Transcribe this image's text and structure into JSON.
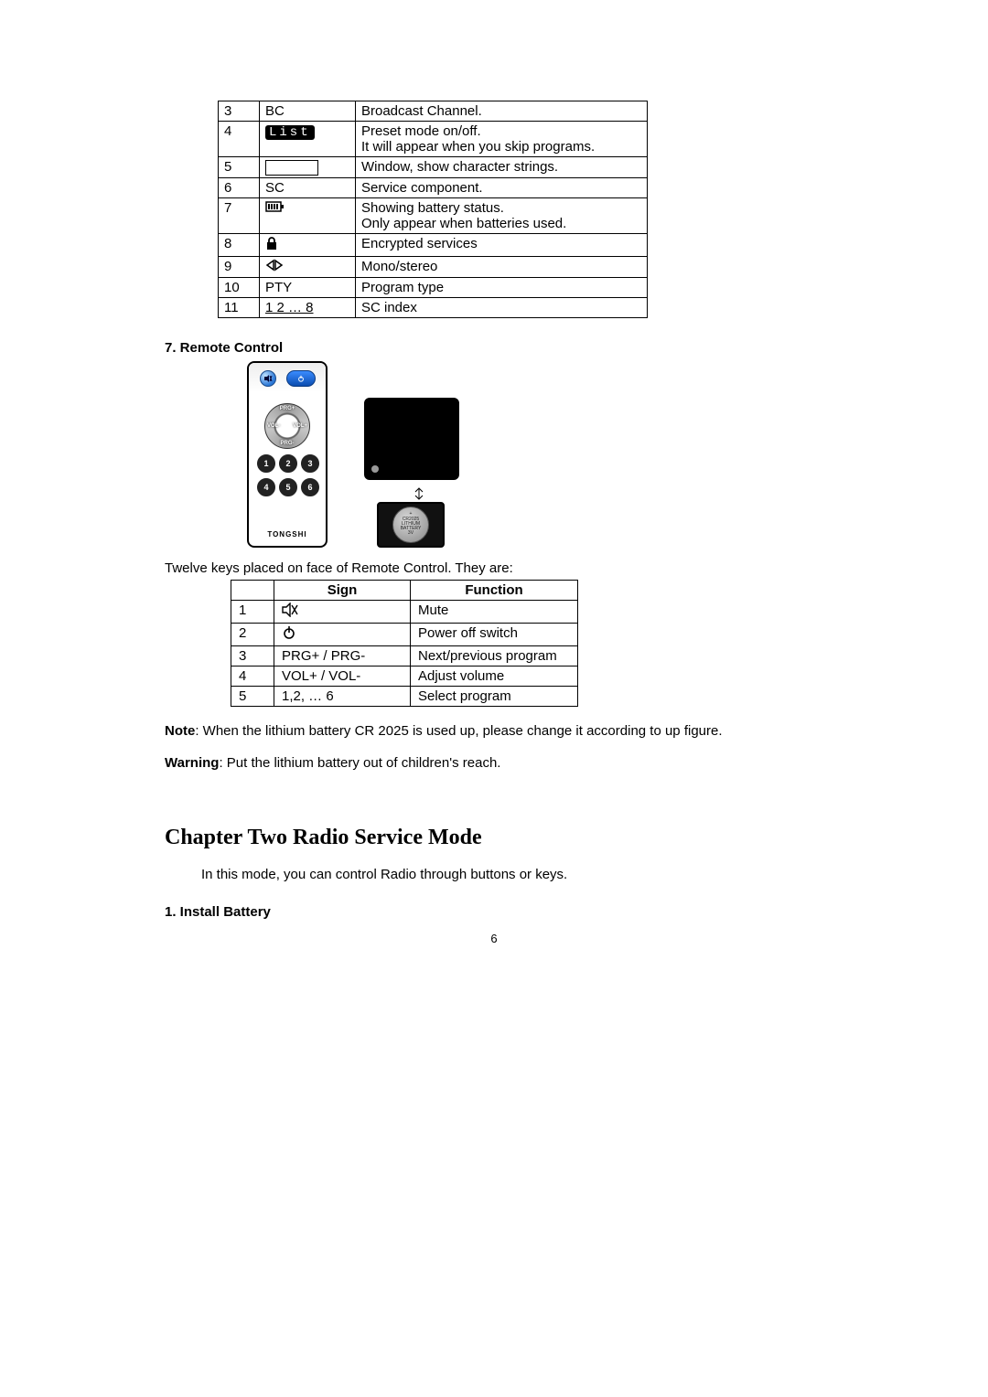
{
  "table1": {
    "rows": [
      {
        "num": "3",
        "sign": "BC",
        "desc": "Broadcast Channel."
      },
      {
        "num": "4",
        "sign": "List",
        "desc": "Preset mode on/off.\nIt will appear when you skip programs."
      },
      {
        "num": "5",
        "sign": "[window]",
        "desc": "Window, show character strings."
      },
      {
        "num": "6",
        "sign": "SC",
        "desc": "Service component."
      },
      {
        "num": "7",
        "sign": "battery-icon",
        "desc": "Showing battery status.\nOnly appear when batteries used."
      },
      {
        "num": "8",
        "sign": "lock-icon",
        "desc": "Encrypted services"
      },
      {
        "num": "9",
        "sign": "mono-stereo-icon",
        "desc": "Mono/stereo"
      },
      {
        "num": "10",
        "sign": "PTY",
        "desc": "Program type"
      },
      {
        "num": "11",
        "sign": "1 2 … 8",
        "desc": "SC index"
      }
    ]
  },
  "section7_title": "7. Remote Control",
  "remote": {
    "brand": "TONGSHI",
    "ring": {
      "up": "PRG+",
      "down": "PRG-",
      "left": "VOL-",
      "right": "VOL+"
    },
    "numbers": [
      "1",
      "2",
      "3",
      "4",
      "5",
      "6"
    ],
    "mute_icon": "mute-icon",
    "power_icon": "power-icon",
    "coin_label": "+\nCR2025\nLITHIUM\nBATTERY\n3V"
  },
  "keys_intro": "Twelve keys placed on face of Remote Control. They are:",
  "table2": {
    "headers": {
      "sign": "Sign",
      "func": "Function"
    },
    "rows": [
      {
        "num": "1",
        "sign": "mute-icon",
        "func": "Mute"
      },
      {
        "num": "2",
        "sign": "power-icon",
        "func": "Power off switch"
      },
      {
        "num": "3",
        "sign": "PRG+ / PRG-",
        "func": "Next/previous program"
      },
      {
        "num": "4",
        "sign": "VOL+ / VOL-",
        "func": "Adjust volume"
      },
      {
        "num": "5",
        "sign": "1,2, … 6",
        "func": "Select program"
      }
    ]
  },
  "note_label": "Note",
  "note_text": ": When the lithium battery CR 2025 is used up, please change it according to up figure.",
  "warning_label": "Warning",
  "warning_text": ": Put the lithium battery out of children's reach.",
  "chapter_title": "Chapter Two    Radio Service Mode",
  "chapter_intro": "In this mode, you can control Radio through buttons or keys.",
  "section1_title": "1. Install Battery",
  "page_number": "6"
}
